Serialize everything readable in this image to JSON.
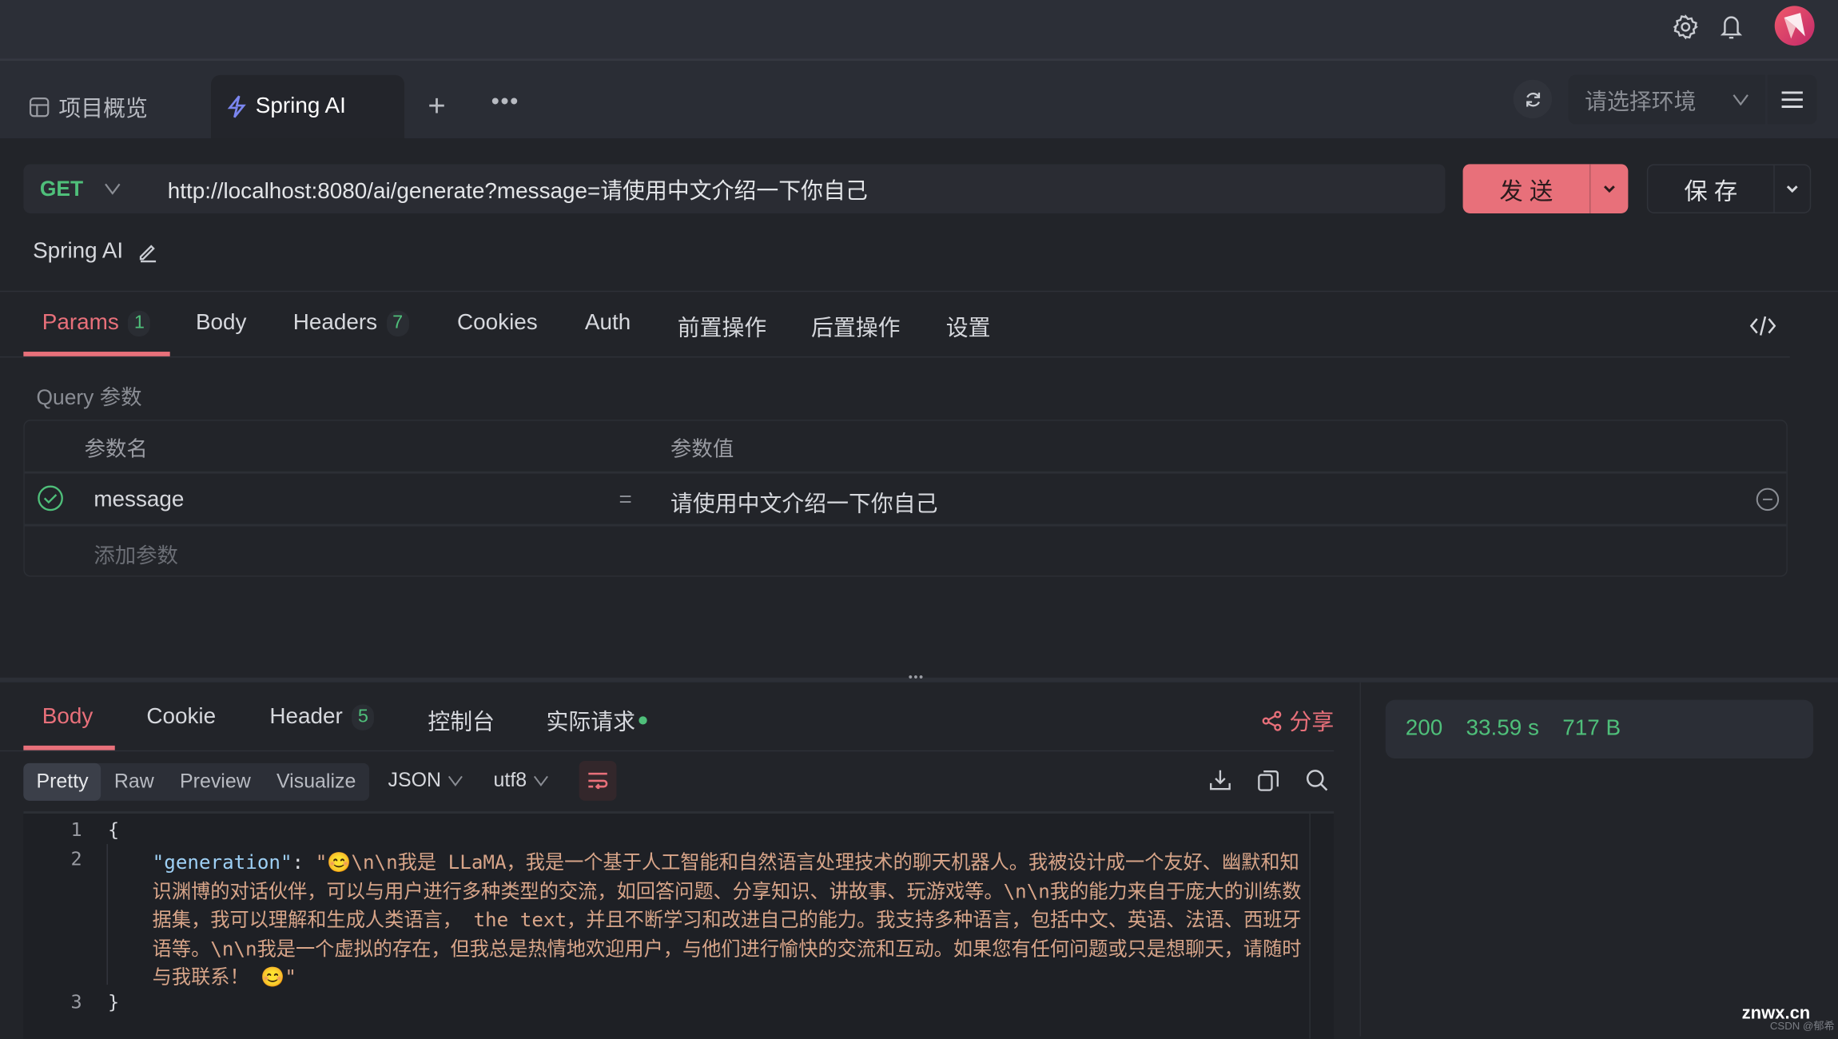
{
  "header": {
    "icons": [
      "gear-icon",
      "bell-icon",
      "avatar"
    ]
  },
  "tabs": {
    "overview_label": "项目概览",
    "active_label": "Spring AI",
    "env_placeholder": "请选择环境"
  },
  "request": {
    "method": "GET",
    "url": "http://localhost:8080/ai/generate?message=请使用中文介绍一下你自己",
    "send_label": "发 送",
    "save_label": "保 存",
    "name": "Spring AI"
  },
  "request_tabs": [
    {
      "label": "Params",
      "badge": "1"
    },
    {
      "label": "Body"
    },
    {
      "label": "Headers",
      "badge": "7"
    },
    {
      "label": "Cookies"
    },
    {
      "label": "Auth"
    },
    {
      "label": "前置操作"
    },
    {
      "label": "后置操作"
    },
    {
      "label": "设置"
    }
  ],
  "params": {
    "section_title": "Query 参数",
    "col_name": "参数名",
    "col_value": "参数值",
    "rows": [
      {
        "name": "message",
        "eq": "=",
        "value": "请使用中文介绍一下你自己",
        "enabled": true
      }
    ],
    "add_placeholder": "添加参数"
  },
  "response_tabs": [
    {
      "label": "Body"
    },
    {
      "label": "Cookie"
    },
    {
      "label": "Header",
      "badge": "5"
    },
    {
      "label": "控制台"
    },
    {
      "label": "实际请求"
    }
  ],
  "share_label": "分享",
  "format": {
    "modes": [
      "Pretty",
      "Raw",
      "Preview",
      "Visualize"
    ],
    "active_mode": "Pretty",
    "type": "JSON",
    "encoding": "utf8"
  },
  "response_body": {
    "line_numbers": [
      "1",
      "2",
      "3"
    ],
    "open_brace": "{",
    "close_brace": "}",
    "key": "\"generation\"",
    "colon": ": ",
    "lines": [
      "\"😊\\n\\n我是 LLaMA，我是一个基于人工智能和自然语言处理技术的聊天机器人。我被设计成一个友好、幽默和知",
      "识渊博的对话伙伴，可以与用户进行多种类型的交流，如回答问题、分享知识、讲故事、玩游戏等。\\n\\n我的能力来自于庞大的训练数",
      "据集，我可以理解和生成人类语言， the text，并且不断学习和改进自己的能力。我支持多种语言，包括中文、英语、法语、西班牙",
      "语等。\\n\\n我是一个虚拟的存在，但我总是热情地欢迎用户，与他们进行愉快的交流和互动。如果您有任何问题或只是想聊天，请随时",
      "与我联系！ 😊\""
    ]
  },
  "status": {
    "code": "200",
    "time": "33.59 s",
    "size": "717 B"
  },
  "watermark": {
    "site": "znwx.cn",
    "author": "CSDN @郁希"
  },
  "colors": {
    "accent": "#e8707a",
    "success": "#4fbf7a",
    "background": "#222429"
  }
}
